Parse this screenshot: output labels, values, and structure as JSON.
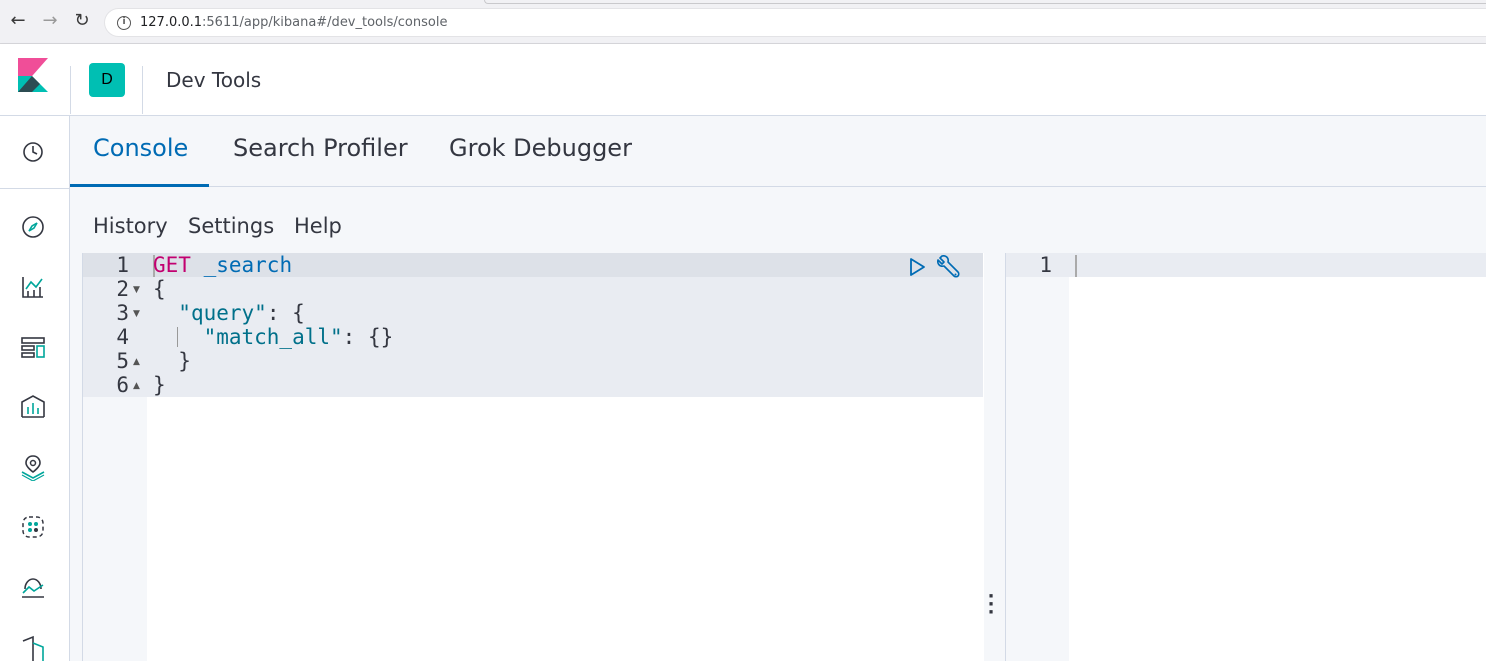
{
  "browser": {
    "url_host": "127.0.0.1",
    "url_rest": ":5611/app/kibana#/dev_tools/console"
  },
  "header": {
    "space_initial": "D",
    "breadcrumb": "Dev Tools"
  },
  "left_nav": {
    "icons": [
      "clock-icon",
      "compass-icon",
      "visualize-icon",
      "dashboard-icon",
      "canvas-icon",
      "maps-icon",
      "ml-icon",
      "infrastructure-icon",
      "logs-icon"
    ]
  },
  "tabs": [
    {
      "label": "Console",
      "active": true
    },
    {
      "label": "Search Profiler",
      "active": false
    },
    {
      "label": "Grok Debugger",
      "active": false
    }
  ],
  "toolbar": {
    "history": "History",
    "settings": "Settings",
    "help": "Help"
  },
  "request_editor": {
    "line_numbers": [
      "1",
      "2",
      "3",
      "4",
      "5",
      "6"
    ],
    "lines": {
      "l1_method": "GET",
      "l1_url": "_search",
      "l2": "{",
      "l3_indent": "  ",
      "l3_key": "\"query\"",
      "l3_rest": ": {",
      "l4_indent": "    ",
      "l4_key": "\"match_all\"",
      "l4_rest": ": {}",
      "l5": "  }",
      "l6": "}"
    }
  },
  "response_editor": {
    "line_numbers": [
      "1"
    ]
  },
  "colors": {
    "accent": "#006bb4",
    "method": "#c20070",
    "string": "#00708a",
    "space_avatar": "#00bfb3"
  }
}
